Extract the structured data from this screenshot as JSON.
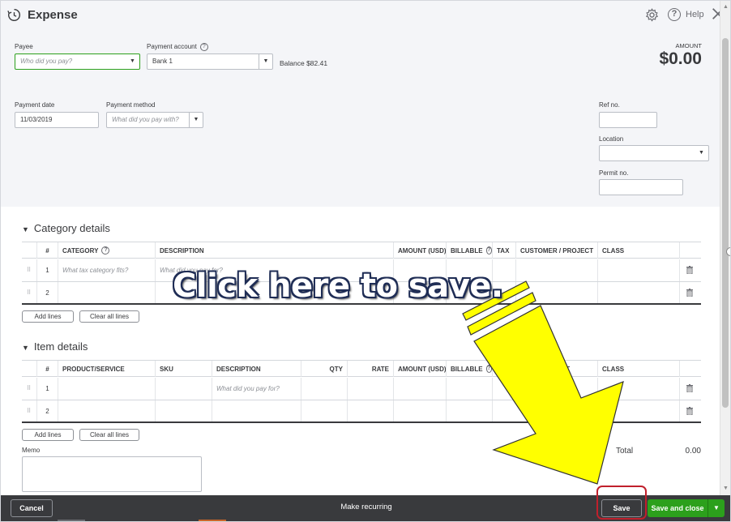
{
  "window": {
    "title": "Expense",
    "help_label": "Help"
  },
  "header": {
    "payee_label": "Payee",
    "payee_placeholder": "Who did you pay?",
    "payment_account_label": "Payment account",
    "payment_account_value": "Bank 1",
    "balance_text": "Balance $82.41",
    "amount_label": "AMOUNT",
    "amount_value": "$0.00",
    "payment_date_label": "Payment date",
    "payment_date_value": "11/03/2019",
    "payment_method_label": "Payment method",
    "payment_method_placeholder": "What did you pay with?",
    "ref_no_label": "Ref no.",
    "location_label": "Location",
    "permit_no_label": "Permit no."
  },
  "category_details": {
    "title": "Category details",
    "columns": [
      "#",
      "CATEGORY",
      "DESCRIPTION",
      "AMOUNT (USD)",
      "BILLABLE",
      "TAX",
      "CUSTOMER / PROJECT",
      "CLASS"
    ],
    "rows": [
      {
        "num": "1",
        "category_placeholder": "What tax category fits?",
        "description_placeholder": "What did you pay for?"
      },
      {
        "num": "2",
        "category_placeholder": "",
        "description_placeholder": ""
      }
    ],
    "add_lines_label": "Add lines",
    "clear_lines_label": "Clear all lines"
  },
  "item_details": {
    "title": "Item details",
    "columns": [
      "#",
      "PRODUCT/SERVICE",
      "SKU",
      "DESCRIPTION",
      "QTY",
      "RATE",
      "AMOUNT (USD)",
      "BILLABLE",
      "CUSTOMER / PROJECT",
      "CLASS"
    ],
    "rows": [
      {
        "num": "1",
        "description_placeholder": "What did you pay for?"
      },
      {
        "num": "2",
        "description_placeholder": ""
      }
    ],
    "add_lines_label": "Add lines",
    "clear_lines_label": "Clear all lines"
  },
  "memo": {
    "label": "Memo"
  },
  "totals": {
    "label": "Total",
    "value": "0.00"
  },
  "footer": {
    "cancel_label": "Cancel",
    "recurring_label": "Make recurring",
    "save_label": "Save",
    "save_close_label": "Save and close"
  },
  "annotation": {
    "text": "Click here to save.",
    "arrow_color": "#ffff00",
    "highlight_color": "#c0202c"
  },
  "colors": {
    "accent_green": "#2ca01c",
    "footer_bg": "#393a3d",
    "header_bg": "#f4f5f8"
  }
}
